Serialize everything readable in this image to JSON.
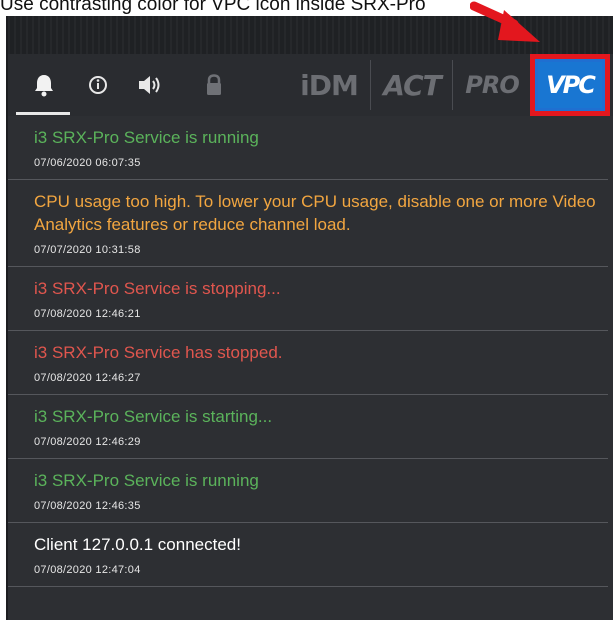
{
  "caption": "Use contrasting color for VPC icon inside SRX-Pro",
  "colors": {
    "green": "#5bb35b",
    "orange": "#f2a640",
    "red": "#e0564e",
    "white": "#ffffff",
    "highlight": "#e3171e",
    "vpc_blue": "#1976d2"
  },
  "toolbar": {
    "tabs": [
      {
        "icon": "bell-icon",
        "active": true
      },
      {
        "icon": "info-icon",
        "active": false
      },
      {
        "icon": "speaker-icon",
        "active": false
      },
      {
        "icon": "lock-icon",
        "active": false
      }
    ],
    "brands": [
      "iDM",
      "ACT",
      "PRO"
    ],
    "vpc_label": "VPC"
  },
  "notifications": [
    {
      "message": "i3 SRX-Pro Service is running",
      "time": "07/06/2020  06:07:35",
      "color": "#5bb35b"
    },
    {
      "message": "CPU usage too high. To lower your CPU usage, disable one or more Video Analytics features or reduce channel load.",
      "time": "07/07/2020  10:31:58",
      "color": "#f2a640"
    },
    {
      "message": "i3 SRX-Pro Service is stopping...",
      "time": "07/08/2020  12:46:21",
      "color": "#e0564e"
    },
    {
      "message": "i3 SRX-Pro Service has stopped.",
      "time": "07/08/2020  12:46:27",
      "color": "#e0564e"
    },
    {
      "message": "i3 SRX-Pro Service is starting...",
      "time": "07/08/2020  12:46:29",
      "color": "#5bb35b"
    },
    {
      "message": "i3 SRX-Pro Service is running",
      "time": "07/08/2020  12:46:35",
      "color": "#5bb35b"
    },
    {
      "message": "Client 127.0.0.1 connected!",
      "time": "07/08/2020  12:47:04",
      "color": "#ffffff"
    }
  ]
}
